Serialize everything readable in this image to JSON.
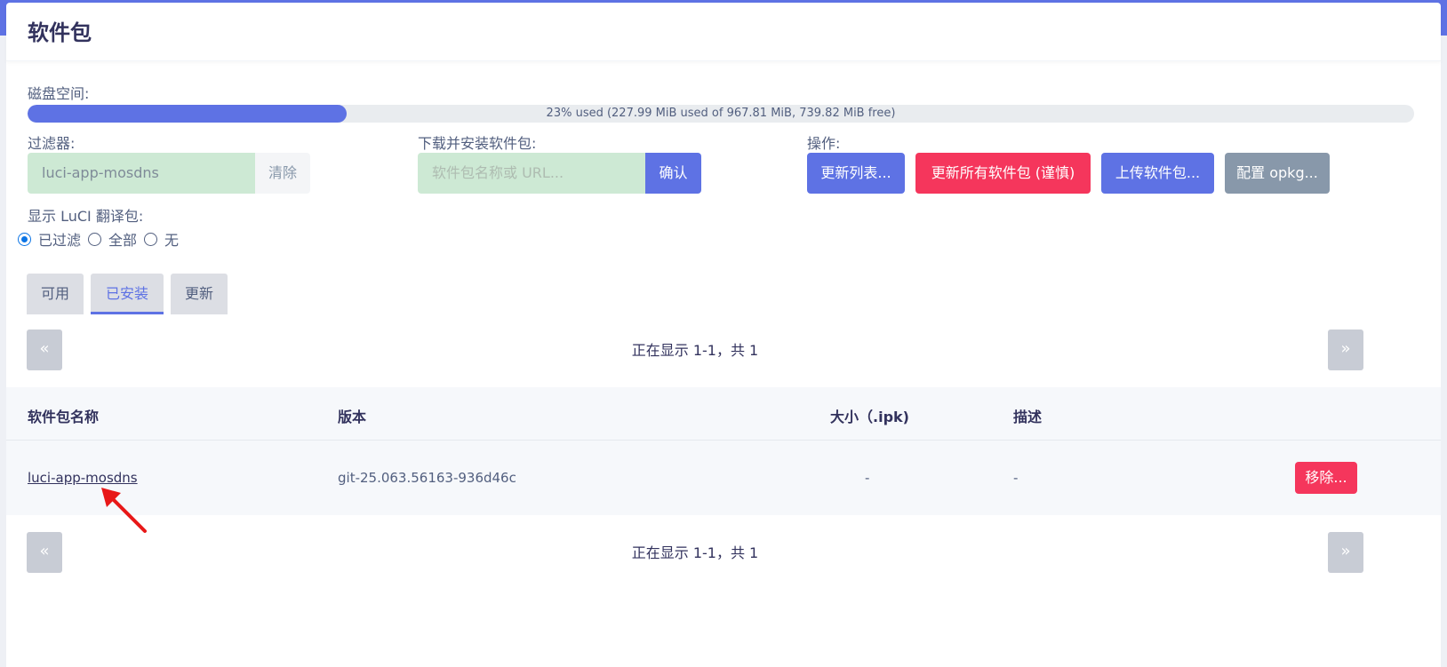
{
  "page": {
    "title": "软件包"
  },
  "disk": {
    "label": "磁盘空间:",
    "used_fraction": 0.23,
    "text": "23% used (227.99 MiB used of 967.81 MiB, 739.82 MiB free)"
  },
  "filter": {
    "label": "过滤器:",
    "value": "luci-app-mosdns",
    "clear_label": "清除"
  },
  "download": {
    "label": "下载并安装软件包:",
    "placeholder": "软件包名称或 URL...",
    "confirm_label": "确认"
  },
  "actions": {
    "label": "操作:",
    "update_lists": "更新列表...",
    "upgrade_all": "更新所有软件包 (谨慎)",
    "upload": "上传软件包...",
    "configure": "配置 opkg..."
  },
  "translations": {
    "label": "显示 LuCI 翻译包:",
    "options": [
      "已过滤",
      "全部",
      "无"
    ],
    "selected": "已过滤"
  },
  "tabs": [
    "可用",
    "已安装",
    "更新"
  ],
  "active_tab": "已安装",
  "pager": {
    "prev": "«",
    "next": "»",
    "text": "正在显示 1-1，共 1"
  },
  "table": {
    "headers": [
      "软件包名称",
      "版本",
      "大小（.ipk)",
      "描述"
    ],
    "rows": [
      {
        "name": "luci-app-mosdns",
        "version": "git-25.063.56163-936d46c",
        "size": "-",
        "description": "-",
        "action": "移除..."
      }
    ]
  },
  "colors": {
    "primary": "#5e72e4",
    "danger": "#f5365c",
    "gray": "#8898aa",
    "annotation_arrow": "#e81818"
  }
}
